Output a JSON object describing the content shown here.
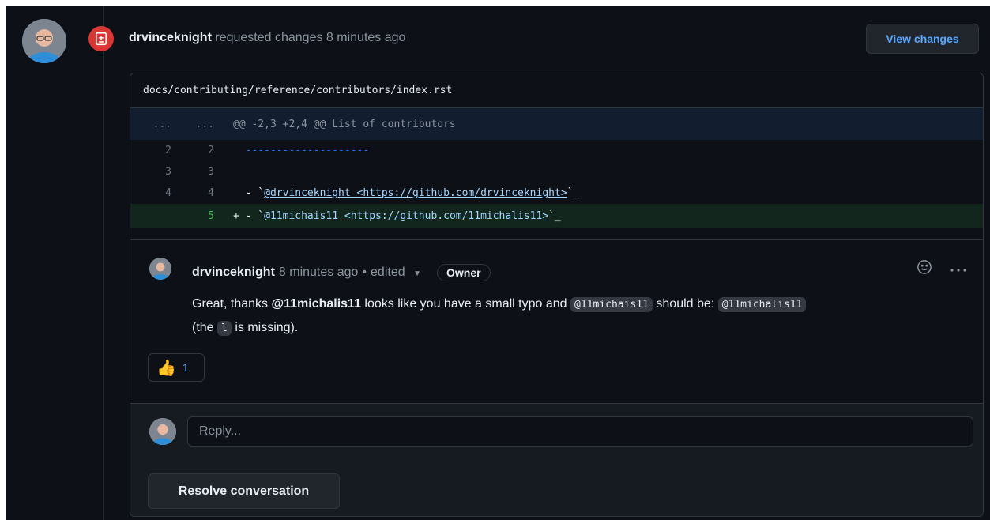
{
  "review": {
    "author": "drvinceknight",
    "action": "requested changes",
    "time": "8 minutes ago",
    "view_changes_label": "View changes"
  },
  "file": {
    "path": "docs/contributing/reference/contributors/index.rst"
  },
  "diff": {
    "hunk_left": "...",
    "hunk_right": "...",
    "hunk_header": "@@ -2,3 +2,4 @@ List of contributors",
    "rows": [
      {
        "old": "2",
        "new": "2",
        "text": "--------------------"
      },
      {
        "old": "3",
        "new": "3",
        "text": ""
      },
      {
        "old": "4",
        "new": "4",
        "prefix": "  - `",
        "link": "@drvinceknight <https://github.com/drvinceknight>",
        "suffix": "`_"
      },
      {
        "old": "",
        "new": "5",
        "prefix": "+ - `",
        "link": "@11michais11 <https://github.com/11michalis11>",
        "suffix": "`_"
      }
    ]
  },
  "comment": {
    "author": "drvinceknight",
    "time": "8 minutes ago",
    "sep": "•",
    "edited_label": "edited",
    "badge": "Owner",
    "body": {
      "p1": "Great, thanks",
      "mention": "@11michalis11",
      "p2": "looks like you have a small typo and",
      "code1": "@11michais11",
      "p3": "should be:",
      "code2": "@11michalis11",
      "p4": "(the",
      "code3": "l",
      "p5": "is missing)."
    },
    "reaction": {
      "emoji": "👍",
      "count": "1"
    }
  },
  "reply": {
    "placeholder": "Reply...",
    "resolve_label": "Resolve conversation"
  },
  "colors": {
    "background": "#0d1117",
    "accent": "#58a6ff",
    "danger": "#da3633",
    "addition": "#12261e"
  }
}
